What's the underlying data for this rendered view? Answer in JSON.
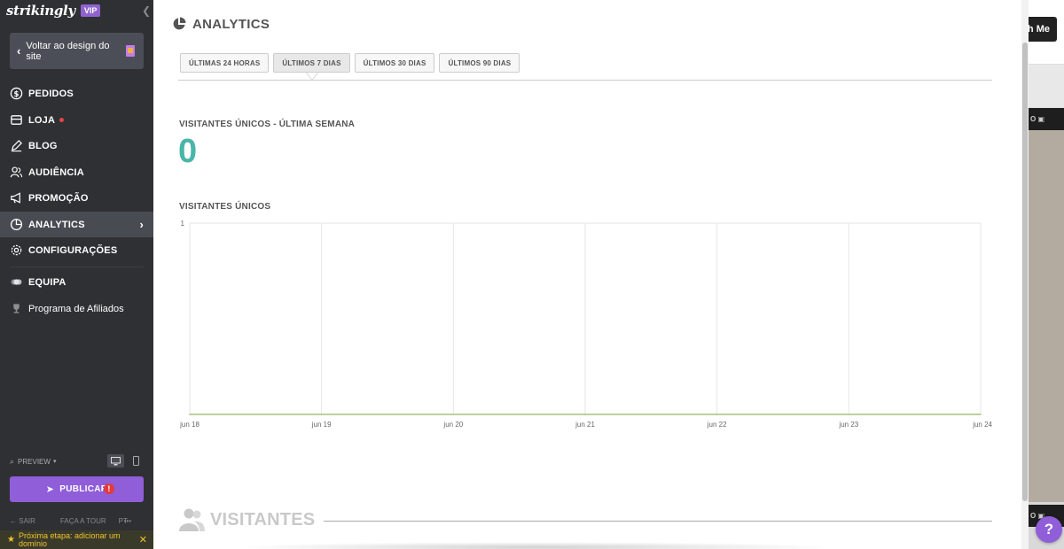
{
  "sidebar": {
    "logo": "strikingly",
    "vip_badge": "VIP",
    "back_button": "Voltar ao design do site",
    "nav": [
      {
        "label": "PEDIDOS",
        "icon": "dollar-circle-icon"
      },
      {
        "label": "LOJA",
        "icon": "store-icon",
        "badge_dot": true
      },
      {
        "label": "BLOG",
        "icon": "pen-icon"
      },
      {
        "label": "AUDIÊNCIA",
        "icon": "users-icon"
      },
      {
        "label": "PROMOÇÃO",
        "icon": "megaphone-icon"
      },
      {
        "label": "ANALYTICS",
        "icon": "pie-chart-icon",
        "active": true
      },
      {
        "label": "CONFIGURAÇÕES",
        "icon": "gear-icon"
      },
      {
        "label": "EQUIPA",
        "icon": "team-icon"
      },
      {
        "label": "Programa de Afiliados",
        "icon": "trophy-icon"
      }
    ],
    "preview_label": "PREVIEW",
    "publish_label": "PUBLICAR",
    "footer": {
      "exit": "SAIR",
      "tour": "FAÇA A TOUR",
      "lang": "PT",
      "more": "•••"
    },
    "next_step": "Próxima etapa: adicionar um domínio"
  },
  "main": {
    "title": "ANALYTICS",
    "tabs": [
      "ÚLTIMAS 24 HORAS",
      "ÚLTIMOS 7 DIAS",
      "ÚLTIMOS 30 DIAS",
      "ÚLTIMOS 90 DIAS"
    ],
    "active_tab": 1,
    "unique_visitors_week_label": "VISITANTES ÚNICOS - ÚLTIMA SEMANA",
    "unique_visitors_week_value": "0",
    "chart_label": "VISITANTES ÚNICOS",
    "section_visitors": "VISITANTES"
  },
  "right_preview": {
    "button_text": "th Me",
    "help": "?"
  },
  "colors": {
    "accent": "#8f5ed8",
    "teal": "#4ab5a9",
    "line": "#a9c27a",
    "sidebar_bg": "#2f3033"
  },
  "chart_data": {
    "type": "line",
    "categories": [
      "jun 18",
      "jun 19",
      "jun 20",
      "jun 21",
      "jun 22",
      "jun 23",
      "jun 24"
    ],
    "series": [
      {
        "values": [
          0,
          0,
          0,
          0,
          0,
          0,
          0
        ]
      }
    ],
    "xlabel": "",
    "ylabel": "",
    "ylim": [
      0,
      1
    ],
    "y_ticks": [
      "1"
    ],
    "grid": "vertical"
  }
}
